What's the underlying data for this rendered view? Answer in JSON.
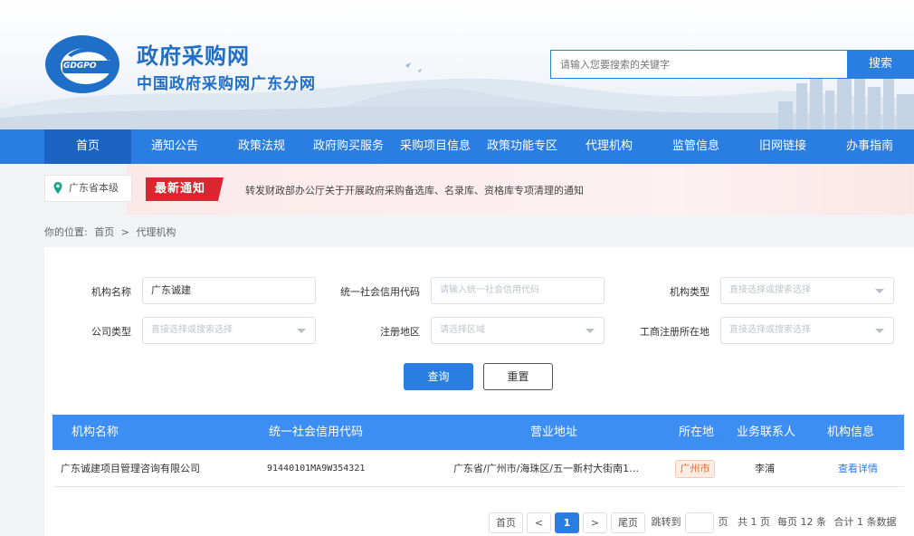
{
  "header": {
    "logo_text": "GDGPO",
    "title": "政府采购网",
    "subtitle": "中国政府采购网广东分网",
    "search_placeholder": "请输入您要搜索的关键字",
    "search_button": "搜索"
  },
  "nav": {
    "items": [
      {
        "label": "首页",
        "active": true
      },
      {
        "label": "通知公告"
      },
      {
        "label": "政策法规"
      },
      {
        "label": "政府购买服务"
      },
      {
        "label": "采购项目信息"
      },
      {
        "label": "政策功能专区"
      },
      {
        "label": "代理机构"
      },
      {
        "label": "监管信息"
      },
      {
        "label": "旧网链接"
      },
      {
        "label": "办事指南"
      }
    ]
  },
  "notice": {
    "location": "广东省本级",
    "badge": "最新通知",
    "text": "转发财政部办公厅关于开展政府采购备选库、名录库、资格库专项清理的通知"
  },
  "breadcrumb": {
    "prefix": "你的位置:",
    "home": "首页",
    "separator": ">",
    "current": "代理机构"
  },
  "form": {
    "org_name_label": "机构名称",
    "org_name_value": "广东诚建",
    "credit_code_label": "统一社会信用代码",
    "credit_code_placeholder": "请输入统一社会信用代码",
    "org_type_label": "机构类型",
    "org_type_placeholder": "直接选择或搜索选择",
    "company_type_label": "公司类型",
    "company_type_placeholder": "直接选择或搜索选择",
    "region_label": "注册地区",
    "region_placeholder": "请选择区域",
    "biz_location_label": "工商注册所在地",
    "biz_location_placeholder": "直接选择或搜索选择",
    "query_button": "查询",
    "reset_button": "重置"
  },
  "table": {
    "columns": [
      "机构名称",
      "统一社会信用代码",
      "营业地址",
      "所在地",
      "业务联系人",
      "机构信息"
    ],
    "rows": [
      {
        "name": "广东诚建项目管理咨询有限公司",
        "credit_code": "91440101MA9W354321",
        "address": "广东省/广州市/海珠区/五一新村大街南1…",
        "city": "广州市",
        "contact": "李浦",
        "action": "查看详情"
      }
    ]
  },
  "pagination": {
    "first": "首页",
    "prev": "<",
    "current": "1",
    "next": ">",
    "last": "尾页",
    "jump_label": "跳转到",
    "page_unit": "页",
    "total_pages": "共 1 页",
    "per_page": "每页 12 条",
    "total_records": "合计 1 条数据"
  },
  "colors": {
    "primary": "#2a7de1",
    "nav_active": "#1a63c2",
    "badge_red": "#d9262f",
    "city_orange": "#e86a2c"
  }
}
